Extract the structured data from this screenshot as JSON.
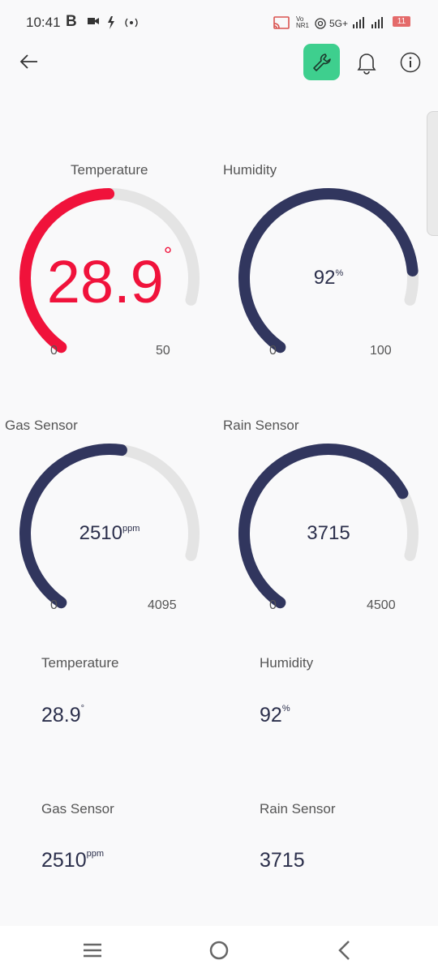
{
  "status_bar": {
    "time": "10:41",
    "b_icon": "B",
    "network": "5G+",
    "battery": "11"
  },
  "toolbar": {
    "back": "back-arrow-icon",
    "tools": "wrench-icon",
    "bell": "bell-icon",
    "info": "info-icon",
    "tools_color": "#3ecf8e"
  },
  "gauges": [
    {
      "label": "Temperature",
      "value": "28.9",
      "unit": "°",
      "min": "0",
      "max": "50",
      "level": 0.578,
      "color": "#f0123b"
    },
    {
      "label": "Humidity",
      "value": "92",
      "unit": "%",
      "min": "0",
      "max": "100",
      "level": 0.92,
      "color": "#31365e"
    },
    {
      "label": "Gas Sensor",
      "value": "2510",
      "unit": "ppm",
      "min": "0",
      "max": "4095",
      "level": 0.613,
      "color": "#31365e"
    },
    {
      "label": "Rain Sensor",
      "value": "3715",
      "unit": "",
      "min": "0",
      "max": "4500",
      "level": 0.826,
      "color": "#31365e"
    }
  ],
  "cards": [
    {
      "label": "Temperature",
      "value": "28.9",
      "unit": "°"
    },
    {
      "label": "Humidity",
      "value": "92",
      "unit": "%"
    },
    {
      "label": "Gas Sensor",
      "value": "2510",
      "unit": "ppm"
    },
    {
      "label": "Rain Sensor",
      "value": "3715",
      "unit": ""
    }
  ],
  "nav": {
    "menu": "menu-icon",
    "home": "home-icon",
    "back": "back-icon"
  },
  "colors": {
    "track": "#e4e4e4",
    "text": "#2b2f4b"
  }
}
